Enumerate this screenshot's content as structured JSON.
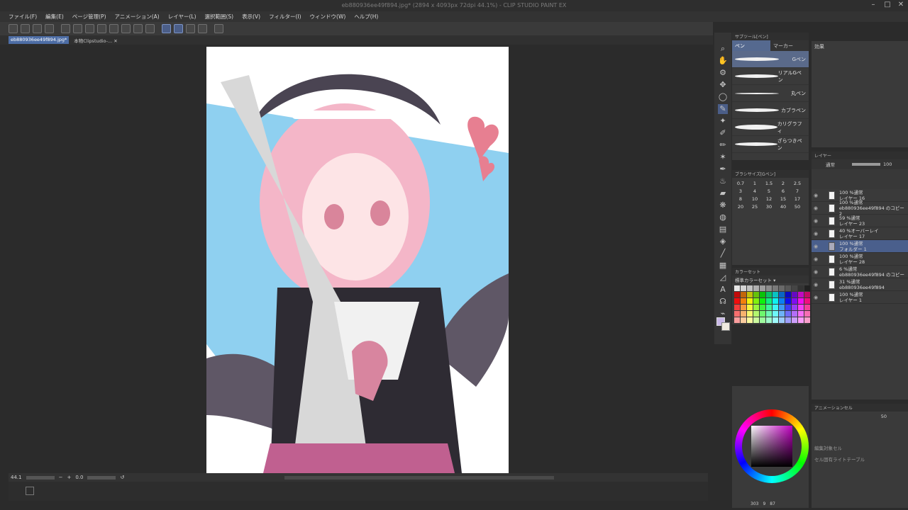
{
  "window": {
    "title": "eb880936ee49f894.jpg* (2894 x 4093px 72dpi 44.1%) - CLIP STUDIO PAINT EX"
  },
  "menu": [
    "ファイル(F)",
    "編集(E)",
    "ページ管理(P)",
    "アニメーション(A)",
    "レイヤー(L)",
    "選択範囲(S)",
    "表示(V)",
    "フィルター(I)",
    "ウィンドウ(W)",
    "ヘルプ(H)"
  ],
  "tabs": [
    {
      "label": "eb880936ee49f894.jpg*",
      "active": true
    },
    {
      "label": "本物Clipstudio-...",
      "active": false
    }
  ],
  "status": {
    "zoom": "44.1",
    "angle": "0.0"
  },
  "subtool_panel": {
    "header": "サブツール[ペン]",
    "tab_pen": "ペン",
    "tab_marker": "マーカー",
    "brushes": [
      {
        "name": "Gペン",
        "selected": true
      },
      {
        "name": "リアルGペン",
        "selected": false
      },
      {
        "name": "丸ペン",
        "selected": false
      },
      {
        "name": "カブラペン",
        "selected": false
      },
      {
        "name": "カリグラフィ",
        "selected": false
      },
      {
        "name": "ざらつきペン",
        "selected": false
      }
    ]
  },
  "brush_size": {
    "header": "ブラシサイズ[Gペン]",
    "sizes": [
      "0.7",
      "1",
      "1.5",
      "2",
      "2.5",
      "3",
      "4",
      "5",
      "6",
      "7",
      "8",
      "10",
      "12",
      "15",
      "17",
      "20",
      "25",
      "30",
      "40",
      "50"
    ]
  },
  "color_set": {
    "header": "カラーセット",
    "set_name": "標準カラーセット"
  },
  "effect_panel": {
    "header": "効果"
  },
  "layer_panel": {
    "header": "レイヤー",
    "blend_mode": "通常",
    "opacity": "100",
    "layers": [
      {
        "line1": "100 %通常",
        "line2": "レイヤー 16",
        "selected": false
      },
      {
        "line1": "100 %通常",
        "line2": "eb880936ee49f894 のコピー 2",
        "selected": false
      },
      {
        "line1": "59 %通常",
        "line2": "レイヤー 23",
        "selected": false
      },
      {
        "line1": "40 %オーバーレイ",
        "line2": "レイヤー 17",
        "selected": false
      },
      {
        "line1": "100 %通常",
        "line2": "フォルダー 1",
        "selected": true
      },
      {
        "line1": "100 %通常",
        "line2": "レイヤー 28",
        "selected": false
      },
      {
        "line1": "6 %通常",
        "line2": "eb880936ee49f894 のコピー",
        "selected": false
      },
      {
        "line1": "31 %通常",
        "line2": "eb880936ee49f894",
        "selected": false
      },
      {
        "line1": "100 %通常",
        "line2": "レイヤー 1",
        "selected": false
      }
    ]
  },
  "animation_panel": {
    "header": "アニメーションセル",
    "opacity": "50",
    "target_cell": "編集対象セル",
    "light_table": "セル固有ライトテーブル"
  },
  "color_wheel": {
    "readout": "303",
    "readout2": "9",
    "readout3": "87"
  },
  "colors": {
    "accent": "#4d6da5",
    "sky": "#8fd0f0",
    "heart": "#e77f91"
  }
}
